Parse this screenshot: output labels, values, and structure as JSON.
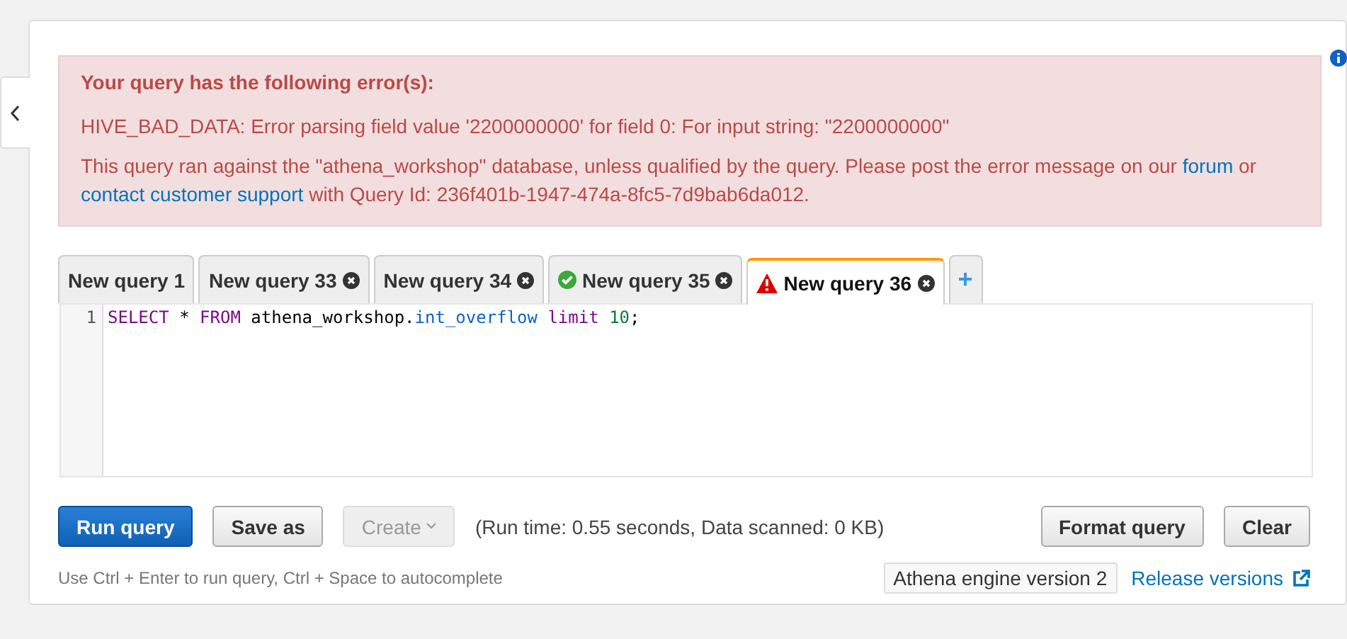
{
  "error": {
    "title": "Your query has the following error(s):",
    "message": "HIVE_BAD_DATA: Error parsing field value '2200000000' for field 0: For input string: \"2200000000\"",
    "note": [
      {
        "kind": "text",
        "text": "This query ran against the \"athena_workshop\" database, unless qualified by the query. Please post the error message on our "
      },
      {
        "kind": "link",
        "text": "forum"
      },
      {
        "kind": "text",
        "text": " or "
      },
      {
        "kind": "link",
        "text": "contact customer support"
      },
      {
        "kind": "text",
        "text": " with Query Id: 236f401b-1947-474a-8fc5-7d9bab6da012."
      }
    ]
  },
  "tabs": [
    {
      "label": "New query 1",
      "closable": false,
      "kind": "plain",
      "selected": false
    },
    {
      "label": "New query 33",
      "closable": true,
      "kind": "plain",
      "selected": false
    },
    {
      "label": "New query 34",
      "closable": true,
      "kind": "plain",
      "selected": false
    },
    {
      "label": "New query 35",
      "closable": true,
      "kind": "success",
      "selected": false
    },
    {
      "label": "New query 36",
      "closable": true,
      "kind": "failed",
      "selected": true
    },
    {
      "label": "+",
      "kind": "add"
    }
  ],
  "editor": {
    "lines": [
      {
        "number": "1",
        "tokens": [
          {
            "kind": "keyword",
            "text": "SELECT"
          },
          {
            "kind": "plain",
            "text": " * "
          },
          {
            "kind": "keyword",
            "text": "FROM"
          },
          {
            "kind": "plain",
            "text": " athena_workshop."
          },
          {
            "kind": "property",
            "text": "int_overflow"
          },
          {
            "kind": "keyword",
            "text": " limit "
          },
          {
            "kind": "number",
            "text": "10"
          },
          {
            "kind": "plain",
            "text": ";"
          }
        ]
      }
    ]
  },
  "actions": [
    {
      "label": "Run query",
      "kind": "primary",
      "disabled": false
    },
    {
      "label": "Save as",
      "kind": "default",
      "disabled": false
    },
    {
      "label": "Create",
      "kind": "dropdown",
      "disabled": true
    }
  ],
  "run_info": "(Run time: 0.55 seconds, Data scanned: 0 KB)",
  "right_actions": [
    "Format query",
    "Clear"
  ],
  "hint": "Use Ctrl + Enter to run query, Ctrl + Space to autocomplete",
  "engine": "Athena engine version 2",
  "release_link": "Release versions"
}
